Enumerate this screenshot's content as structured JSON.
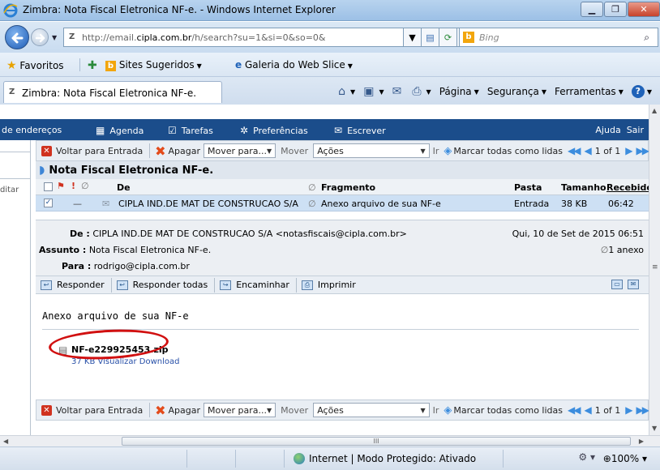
{
  "window": {
    "title": "Zimbra: Nota Fiscal Eletronica NF-e. - Windows Internet Explorer",
    "minimize": "▁",
    "maximize": "❐",
    "close": "✕"
  },
  "address_bar": {
    "url_prefix": "http://email.",
    "url_host": "cipla.com.br",
    "url_rest": "/h/search?su=1&si=0&so=0&",
    "search_engine": "Bing",
    "favicon": "Z"
  },
  "favorites_bar": {
    "favorites": "Favoritos",
    "suggested_sites": "Sites Sugeridos",
    "web_slice": "Galeria do Web Slice"
  },
  "tab": {
    "label": "Zimbra: Nota Fiscal Eletronica NF-e.",
    "favicon": "Z"
  },
  "command_bar": {
    "page": "Página",
    "security": "Segurança",
    "tools": "Ferramentas"
  },
  "app_nav": {
    "address_book": "de endereços",
    "calendar": "Agenda",
    "tasks": "Tarefas",
    "preferences": "Preferências",
    "compose": "Escrever",
    "help": "Ajuda",
    "signout": "Sair"
  },
  "left_pane": {
    "edit_label": "ditar"
  },
  "toolbar": {
    "back_to_inbox": "Voltar para Entrada",
    "delete": "Apagar",
    "move_to": "Mover para...",
    "move": "Mover",
    "actions": "Ações",
    "go": "Ir",
    "mark_all_read": "Marcar todas como lidas",
    "page_info": "1 of 1"
  },
  "conversation": {
    "subject": "Nota Fiscal Eletronica NF-e."
  },
  "list": {
    "columns": {
      "from": "De",
      "fragment": "Fragmento",
      "folder": "Pasta",
      "size": "Tamanho",
      "received": "Recebido"
    },
    "rows": [
      {
        "checked": "✓",
        "dash": "—",
        "from": "CIPLA IND.DE MAT DE CONSTRUCAO S/A",
        "fragment": "Anexo arquivo de sua NF-e",
        "folder": "Entrada",
        "size": "38 KB",
        "received": "06:42"
      }
    ]
  },
  "message": {
    "from_label": "De :",
    "from_value": "CIPLA IND.DE MAT DE CONSTRUCAO S/A <notasfiscais@cipla.com.br>",
    "date": "Qui, 10 de Set de 2015 06:51",
    "subject_label": "Assunto :",
    "subject_value": "Nota Fiscal Eletronica NF-e.",
    "attachments_count": "1 anexo",
    "to_label": "Para :",
    "to_value": "rodrigo@cipla.com.br",
    "body": "Anexo arquivo de sua NF-e",
    "attachment_name": "NF-e229925453.zip",
    "attachment_links": "37 KB  Visualizar  Download"
  },
  "message_actions": {
    "reply": "Responder",
    "reply_all": "Responder todas",
    "forward": "Encaminhar",
    "print": "Imprimir"
  },
  "hscroll": {
    "grip": "III"
  },
  "status_bar": {
    "zone": "Internet | Modo Protegido: Ativado",
    "zoom": "100%"
  },
  "colors": {
    "app_nav_bg": "#1b4d8b",
    "selected_row": "#cde0f4",
    "annotation_circle": "#d11010"
  }
}
